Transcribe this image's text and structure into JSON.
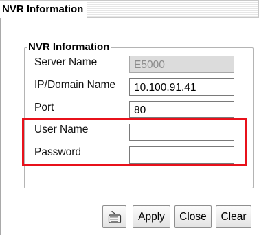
{
  "window": {
    "title": "NVR Information"
  },
  "group": {
    "legend": "NVR Information"
  },
  "fields": {
    "server_name": {
      "label": "Server Name",
      "value": "E5000",
      "enabled": false
    },
    "ip_domain": {
      "label": "IP/Domain Name",
      "value": "10.100.91.41"
    },
    "port": {
      "label": "Port",
      "value": "80"
    },
    "user_name": {
      "label": "User Name",
      "value": ""
    },
    "password": {
      "label": "Password",
      "value": ""
    }
  },
  "buttons": {
    "keyboard_icon": "keyboard-icon",
    "apply": "Apply",
    "close": "Close",
    "clear": "Clear"
  },
  "colors": {
    "highlight": "#e8111b",
    "disabled_field": "#dcdcdc"
  }
}
